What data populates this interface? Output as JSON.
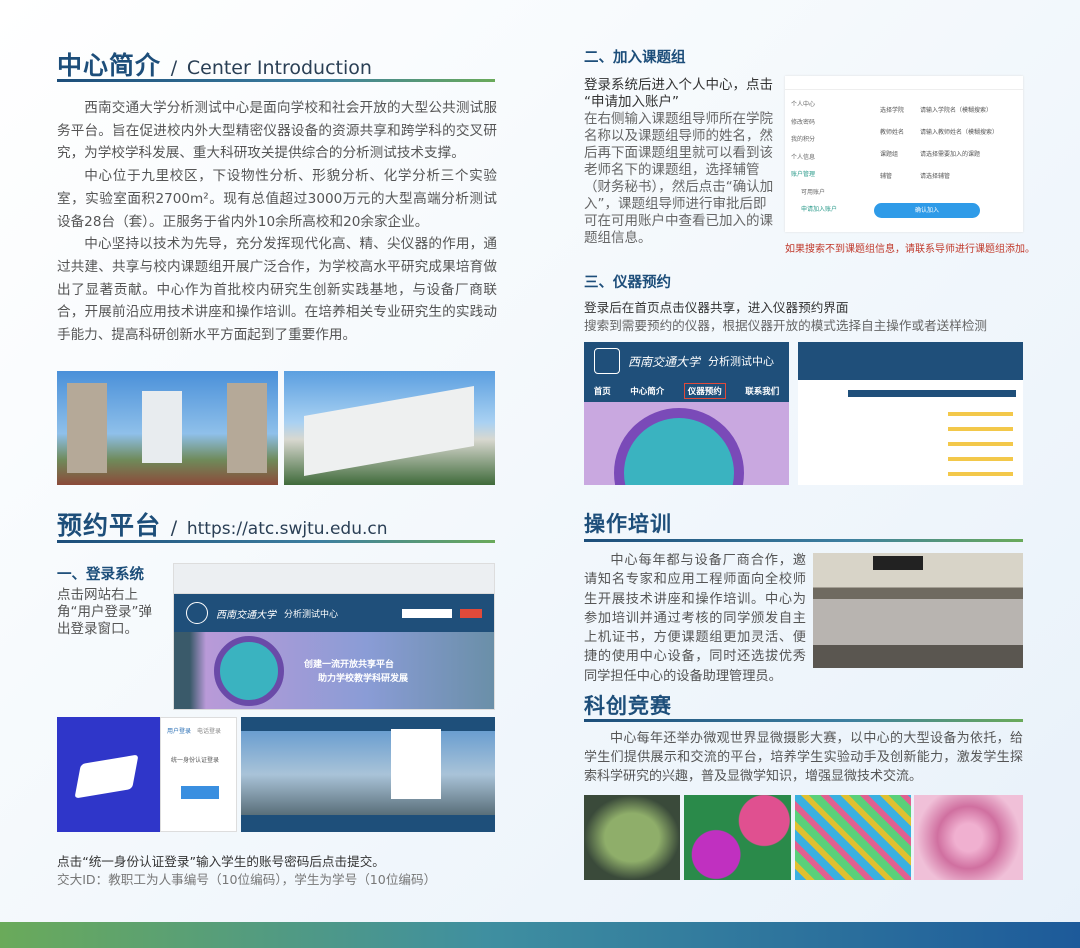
{
  "intro": {
    "title": "中心简介",
    "sep": "/",
    "title_en": "Center Introduction",
    "paragraphs": [
      "西南交通大学分析测试中心是面向学校和社会开放的大型公共测试服务平台。旨在促进校内外大型精密仪器设备的资源共享和跨学科的交叉研究，为学校学科发展、重大科研攻关提供综合的分析测试技术支撑。",
      "中心位于九里校区，下设物性分析、形貌分析、化学分析三个实验室，实验室面积2700m²。现有总值超过3000万元的大型高端分析测试设备28台（套）。正服务于省内外10余所高校和20余家企业。",
      "中心坚持以技术为先导，充分发挥现代化高、精、尖仪器的作用，通过共建、共享与校内课题组开展广泛合作，为学校高水平研究成果培育做出了显著贡献。中心作为首批校内研究生创新实践基地，与设备厂商联合，开展前沿应用技术讲座和操作培训。在培养相关专业研究生的实践动手能力、提高科研创新水平方面起到了重要作用。"
    ]
  },
  "platform": {
    "title": "预约平台",
    "sep": "/",
    "url": "https://atc.swjtu.edu.cn",
    "login": {
      "heading": "一、登录系统",
      "text": "点击网站右上角“用户登录”弹出登录窗口。",
      "site_name": "西南交通大学",
      "site_sub": "分析测试中心",
      "banner_line1": "创建一流开放共享平台",
      "banner_line2": "助力学校教学科研发展",
      "tab1": "用户登录",
      "tab2": "电话登录",
      "unified": "统一身份认证登录",
      "caption1": "点击“统一身份认证登录”输入学生的账号密码后点击提交。",
      "caption2": "交大ID：教职工为人事编号（10位编码），学生为学号（10位编码）"
    }
  },
  "join": {
    "heading": "二、加入课题组",
    "lead1": "登录系统后进入个人中心，点击",
    "lead2": "“申请加入账户”",
    "text": "在右侧输入课题组导师所在学院名称以及课题组导师的姓名，然后再下面课题组里就可以看到该老师名下的课题组，选择辅管（财务秘书），然后点击“确认加入”，课题组导师进行审批后即可在可用账户中查看已加入的课题组信息。",
    "menu": [
      "个人中心",
      "修改密码",
      "我的积分",
      "个人信息",
      "账户管理",
      "可用账户",
      "申请加入账户"
    ],
    "fields": [
      {
        "label": "选择学院",
        "placeholder": "请输入学院名（模糊搜索）"
      },
      {
        "label": "教师姓名",
        "placeholder": "请输入教师姓名（模糊搜索）"
      },
      {
        "label": "课题组",
        "placeholder": "请选择需要加入的课题"
      },
      {
        "label": "辅管",
        "placeholder": "请选择辅管"
      }
    ],
    "confirm": "确认加入",
    "note": "如果搜索不到课题组信息，请联系导师进行课题组添加。"
  },
  "booking": {
    "heading": "三、仪器预约",
    "line1": "登录后在首页点击仪器共享，进入仪器预约界面",
    "line2": "搜索到需要预约的仪器，根据仪器开放的模式选择自主操作或者送样检测",
    "nav": [
      "首页",
      "中心简介",
      "仪器预约",
      "联系我们"
    ]
  },
  "training": {
    "title": "操作培训",
    "text": "中心每年都与设备厂商合作，邀请知名专家和应用工程师面向全校师生开展技术讲座和操作培训。中心为参加培训并通过考核的同学颁发自主上机证书，方便课题组更加灵活、便捷的使用中心设备，同时还选拔优秀同学担任中心的设备助理管理员。"
  },
  "contest": {
    "title": "科创竞赛",
    "text": "中心每年还举办微观世界显微摄影大赛，以中心的大型设备为依托，给学生们提供展示和交流的平台，培养学生实验动手及创新能力，激发学生探索科学研究的兴趣，普及显微学知识，增强显微技术交流。"
  },
  "colors": {
    "primary": "#1d4e7a",
    "accent_green": "#6aaa5a",
    "note_red": "#c0392b"
  }
}
